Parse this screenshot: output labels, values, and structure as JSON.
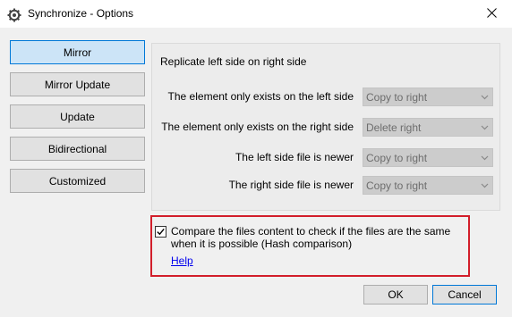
{
  "window": {
    "title": "Synchronize - Options",
    "app_icon": "gear-icon",
    "close_icon": "close-icon"
  },
  "modes": [
    {
      "label": "Mirror",
      "active": true
    },
    {
      "label": "Mirror Update",
      "active": false
    },
    {
      "label": "Update",
      "active": false
    },
    {
      "label": "Bidirectional",
      "active": false
    },
    {
      "label": "Customized",
      "active": false
    }
  ],
  "panel": {
    "title": "Replicate left side on right side",
    "rows": [
      {
        "label": "The element only exists on the left side",
        "value": "Copy to right"
      },
      {
        "label": "The element only exists on the right side",
        "value": "Delete right"
      },
      {
        "label": "The left side file is newer",
        "value": "Copy to right"
      },
      {
        "label": "The right side file is newer",
        "value": "Copy to right"
      }
    ]
  },
  "hash_option": {
    "checked": true,
    "label": "Compare the files content to check if the files are the same when it is possible (Hash comparison)",
    "help": "Help"
  },
  "buttons": {
    "ok": "OK",
    "cancel": "Cancel"
  },
  "colors": {
    "accent": "#0078d7",
    "highlight_border": "#d21e2a",
    "link": "#0000ee"
  }
}
